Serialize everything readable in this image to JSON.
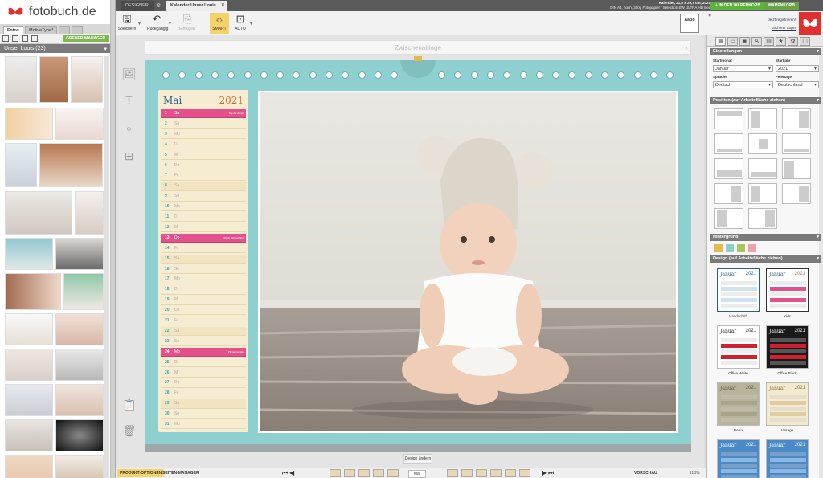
{
  "brand": {
    "name": "fotobuch.de"
  },
  "left": {
    "tabs": [
      "Fotos",
      "MotivеType*"
    ],
    "green_button": "GRENER-MANAGER",
    "album_title": "Unser Louis (23)"
  },
  "topbar": {
    "tab_designer": "DESIGNER",
    "tab_document": "Kalender Unser Louis",
    "product_line1": "Kalender, 21,0 x 29,7 cm, 2021, 00:00",
    "product_line2": "DIN A4, hoch, 300g Fotopapier / Selection SW ULTRA HD",
    "product_link": "Bearbeiten",
    "cart_button": "+ IN DEN WARENKORB",
    "cart2_button": "WARENKORB"
  },
  "toolbar": {
    "save": "Speichern",
    "undo": "Rückgängig",
    "restore": "Einfügen",
    "smart": "SMART",
    "auto": "AUTO",
    "format_box": "AaBb"
  },
  "account": {
    "register": "Jetzt registrieren!",
    "login": "Sicherer Login"
  },
  "canvas": {
    "clipboard": "Zwischenablage",
    "month": "Mai",
    "year": "2021",
    "design_button": "Design ändern"
  },
  "days": [
    {
      "n": "1",
      "w": "Sa",
      "hl": true,
      "note": "Tag der Arbeit"
    },
    {
      "n": "2",
      "w": "So"
    },
    {
      "n": "3",
      "w": "Mo"
    },
    {
      "n": "4",
      "w": "Di"
    },
    {
      "n": "5",
      "w": "Mi"
    },
    {
      "n": "6",
      "w": "Do"
    },
    {
      "n": "7",
      "w": "Fr"
    },
    {
      "n": "8",
      "w": "Sa",
      "sat": true
    },
    {
      "n": "9",
      "w": "So"
    },
    {
      "n": "10",
      "w": "Mo"
    },
    {
      "n": "11",
      "w": "Di"
    },
    {
      "n": "12",
      "w": "Mi"
    },
    {
      "n": "13",
      "w": "Do",
      "hl": true,
      "note": "Christi Himmelfahrt"
    },
    {
      "n": "14",
      "w": "Fr"
    },
    {
      "n": "15",
      "w": "Sa",
      "sat": true
    },
    {
      "n": "16",
      "w": "So"
    },
    {
      "n": "17",
      "w": "Mo"
    },
    {
      "n": "18",
      "w": "Di"
    },
    {
      "n": "19",
      "w": "Mi"
    },
    {
      "n": "20",
      "w": "Do"
    },
    {
      "n": "21",
      "w": "Fr"
    },
    {
      "n": "22",
      "w": "Sa",
      "sat": true
    },
    {
      "n": "23",
      "w": "So"
    },
    {
      "n": "24",
      "w": "Mo",
      "hl": true,
      "note": "Pfingstmontag"
    },
    {
      "n": "25",
      "w": "Di"
    },
    {
      "n": "26",
      "w": "Mi"
    },
    {
      "n": "27",
      "w": "Do"
    },
    {
      "n": "28",
      "w": "Fr"
    },
    {
      "n": "29",
      "w": "Sa",
      "sat": true
    },
    {
      "n": "30",
      "w": "So"
    },
    {
      "n": "31",
      "w": "Mo"
    }
  ],
  "bottombar": {
    "product_options": "PRODUKT-OPTIONEN",
    "page_manager": "SEITEN-MANAGER",
    "current_page": "Mai",
    "preview": "VORSCHAU",
    "zoom": "118%"
  },
  "right": {
    "sec_settings": "Einstellungen",
    "start_month_label": "Startmonat",
    "start_month": "Januar",
    "start_year_label": "Startjahr",
    "start_year": "2021",
    "language_label": "Sprache",
    "language": "Deutsch",
    "holidays_label": "Feiertage",
    "holidays": "Deutschland",
    "sec_position": "Position (auf Arbeitsfläche ziehen)",
    "sec_background": "Hintergrund",
    "sec_design": "Design (auf Arbeitsfläche ziehen)",
    "designs": [
      {
        "label": "Handschrift",
        "month": "Januar",
        "year": "2021"
      },
      {
        "label": "Kids",
        "month": "Januar",
        "year": "2021"
      },
      {
        "label": "Office White",
        "month": "Januar",
        "year": "2021"
      },
      {
        "label": "Office Black",
        "month": "Januar",
        "year": "2021"
      },
      {
        "label": "Retro",
        "month": "Januar",
        "year": "2021"
      },
      {
        "label": "Vintage",
        "month": "Januar",
        "year": "2021"
      },
      {
        "label": "",
        "month": "Januar",
        "year": "2021"
      },
      {
        "label": "",
        "month": "Januar",
        "year": "2021"
      }
    ],
    "swatches": [
      "#e8b84a",
      "#8dd0cf",
      "#a5c85a",
      "#f0a0b0"
    ]
  }
}
